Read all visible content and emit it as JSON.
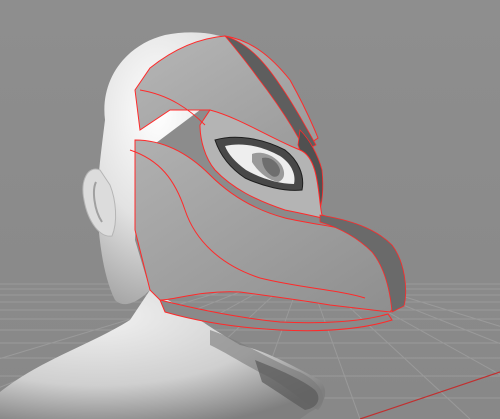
{
  "viewport": {
    "background_color": "#8c8c8c",
    "grid_color": "#9a9a9a",
    "grid_minor_color": "#7a7a7a",
    "model_color": "#e6e6e6",
    "mask_color": "#a9a9a9",
    "edge_highlight_color": "#ff2a2a",
    "objects": [
      "head-bust",
      "dragon-mask",
      "ground-grid"
    ]
  }
}
